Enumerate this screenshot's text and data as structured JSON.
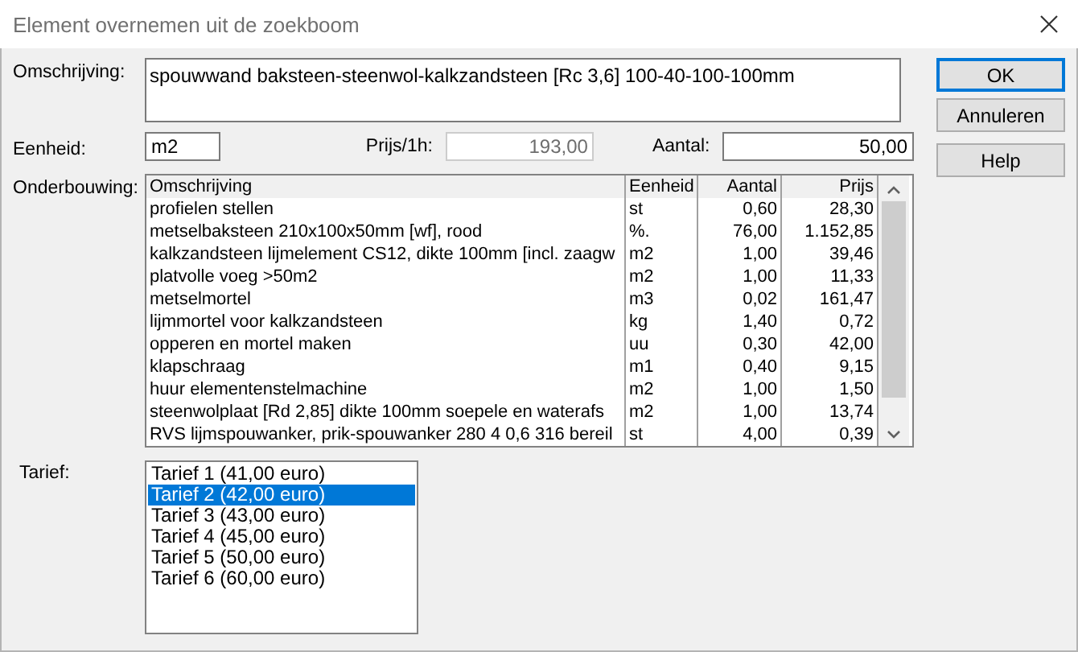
{
  "window": {
    "title": "Element overnemen uit de zoekboom"
  },
  "description": {
    "label": "Omschrijving:",
    "value": "spouwwand baksteen-steenwol-kalkzandsteen [Rc 3,6]  100-40-100-100mm"
  },
  "unit": {
    "label": "Eenheid:",
    "value": "m2"
  },
  "price": {
    "label": "Prijs/1h:",
    "value": "193,00",
    "disabled": true
  },
  "quantity": {
    "label": "Aantal:",
    "value": "50,00"
  },
  "buttons": [
    {
      "label": "OK",
      "default": true
    },
    {
      "label": "Annuleren",
      "default": false
    },
    {
      "label": "Help",
      "default": false
    }
  ],
  "breakdown": {
    "label": "Onderbouwing:",
    "columns": [
      "Omschrijving",
      "Eenheid",
      "Aantal",
      "Prijs"
    ],
    "rows": [
      [
        "profielen stellen",
        "st",
        "0,60",
        "28,30"
      ],
      [
        "metselbaksteen 210x100x50mm [wf], rood",
        "%.",
        "76,00",
        "1.152,85"
      ],
      [
        "kalkzandsteen lijmelement CS12, dikte 100mm [incl. zaagw",
        "m2",
        "1,00",
        "39,46"
      ],
      [
        "platvolle voeg >50m2",
        "m2",
        "1,00",
        "11,33"
      ],
      [
        "metselmortel",
        "m3",
        "0,02",
        "161,47"
      ],
      [
        "lijmmortel voor kalkzandsteen",
        "kg",
        "1,40",
        "0,72"
      ],
      [
        "opperen en mortel maken",
        "uu",
        "0,30",
        "42,00"
      ],
      [
        "klapschraag",
        "m1",
        "0,40",
        "9,15"
      ],
      [
        "huur elementenstelmachine",
        "m2",
        "1,00",
        "1,50"
      ],
      [
        "steenwolplaat [Rd 2,85] dikte 100mm soepele en waterafs",
        "m2",
        "1,00",
        "13,74"
      ],
      [
        "RVS lijmspouwanker, prik-spouwanker 280 4 0,6 316 bereil",
        "st",
        "4,00",
        "0,39"
      ]
    ]
  },
  "rate": {
    "label": "Tarief:",
    "items": [
      {
        "label": "Tarief 1 (41,00 euro)",
        "selected": false
      },
      {
        "label": "Tarief 2 (42,00 euro)",
        "selected": true
      },
      {
        "label": "Tarief 3 (43,00 euro)",
        "selected": false
      },
      {
        "label": "Tarief 4 (45,00 euro)",
        "selected": false
      },
      {
        "label": "Tarief 5 (50,00 euro)",
        "selected": false
      },
      {
        "label": "Tarief 6 (60,00 euro)",
        "selected": false
      }
    ]
  }
}
